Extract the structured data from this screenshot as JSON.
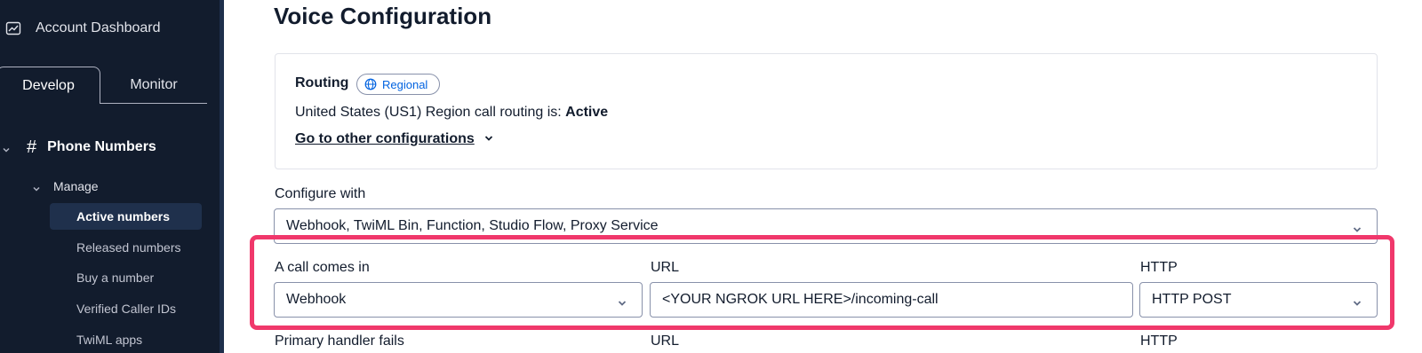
{
  "sidebar": {
    "account_dashboard": "Account Dashboard",
    "tabs": {
      "develop": "Develop",
      "monitor": "Monitor"
    },
    "section": {
      "hash": "#",
      "label": "Phone Numbers"
    },
    "manage": "Manage",
    "items": [
      {
        "label": "Active numbers"
      },
      {
        "label": "Released numbers"
      },
      {
        "label": "Buy a number"
      },
      {
        "label": "Verified Caller IDs"
      },
      {
        "label": "TwiML apps"
      }
    ]
  },
  "main": {
    "title": "Voice Configuration",
    "routing": {
      "label": "Routing",
      "badge": "Regional",
      "status_prefix": "United States (US1) Region call routing is: ",
      "status_value": "Active",
      "link": "Go to other configurations"
    },
    "configure_with": {
      "label": "Configure with",
      "value": "Webhook, TwiML Bin, Function, Studio Flow, Proxy Service"
    },
    "call_comes_in": {
      "label": "A call comes in",
      "type_value": "Webhook",
      "url_label": "URL",
      "url_value": "<YOUR NGROK URL HERE>/incoming-call",
      "http_label": "HTTP",
      "http_value": "HTTP POST"
    },
    "primary_handler": {
      "label": "Primary handler fails",
      "url_label": "URL",
      "http_label": "HTTP"
    }
  },
  "colors": {
    "sidebar_bg": "#121c2d",
    "highlight": "#f0386b",
    "link_blue": "#0263e0"
  }
}
